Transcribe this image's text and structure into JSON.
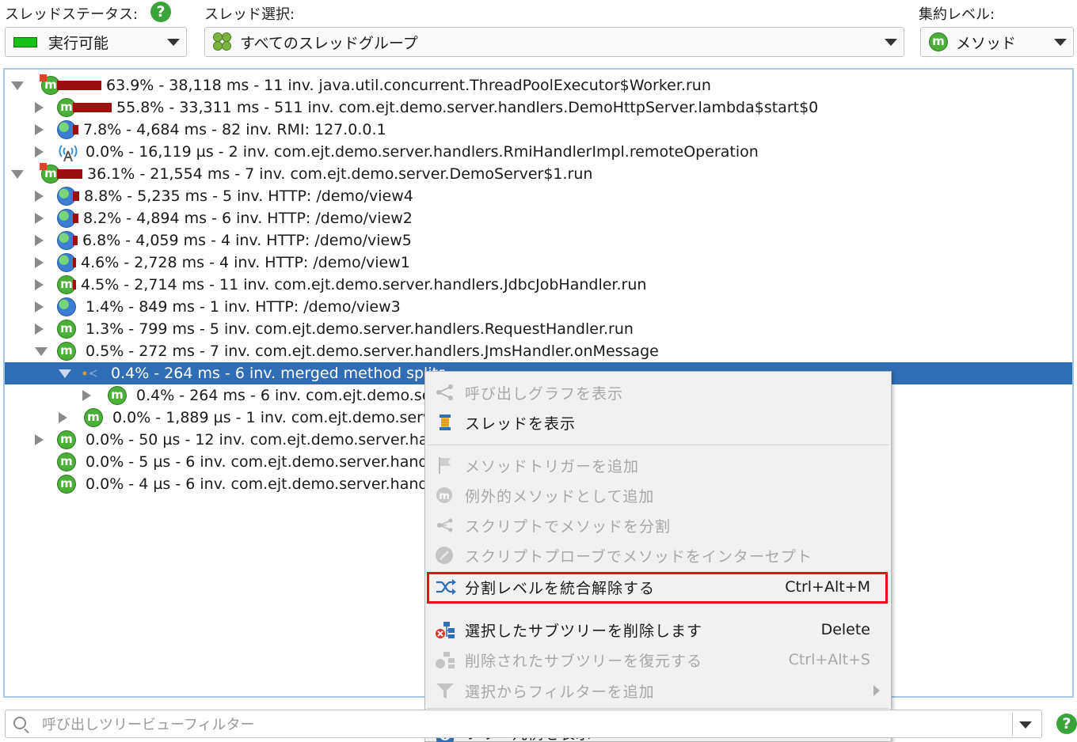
{
  "header": {
    "thread_status_label": "スレッドステータス:",
    "thread_select_label": "スレッド選択:",
    "aggregation_label": "集約レベル:",
    "help_glyph": "?",
    "thread_status_value": "実行可能",
    "thread_select_value": "すべてのスレッドグループ",
    "aggregation_value": "メソッド"
  },
  "icon_glyphs": {
    "method": "m",
    "info": "i"
  },
  "tree": {
    "rows": [
      {
        "text": "63.9% - 38,118 ms - 11 inv. java.util.concurrent.ThreadPoolExecutor$Worker.run",
        "icon": "method-thread-icon",
        "expander": "open",
        "bar": 0.639
      },
      {
        "text": "55.8% - 33,311 ms - 511 inv. com.ejt.demo.server.handlers.DemoHttpServer.lambda$start$0",
        "icon": "method-icon",
        "expander": "closed",
        "bar": 0.558
      },
      {
        "text": "7.8% - 4,684 ms - 82 inv. RMI: 127.0.0.1",
        "icon": "globe-icon",
        "expander": "closed",
        "bar": 0.078
      },
      {
        "text": "0.0% - 16,119 µs - 2 inv. com.ejt.demo.server.handlers.RmiHandlerImpl.remoteOperation",
        "icon": "antenna-icon",
        "expander": "closed",
        "bar": 0
      },
      {
        "text": "36.1% - 21,554 ms - 7 inv. com.ejt.demo.server.DemoServer$1.run",
        "icon": "method-thread-icon",
        "expander": "open",
        "bar": 0.361
      },
      {
        "text": "8.8% - 5,235 ms - 5 inv. HTTP: /demo/view4",
        "icon": "globe-icon",
        "expander": "closed",
        "bar": 0.088
      },
      {
        "text": "8.2% - 4,894 ms - 6 inv. HTTP: /demo/view2",
        "icon": "globe-icon",
        "expander": "closed",
        "bar": 0.082
      },
      {
        "text": "6.8% - 4,059 ms - 4 inv. HTTP: /demo/view5",
        "icon": "globe-icon",
        "expander": "closed",
        "bar": 0.068
      },
      {
        "text": "4.6% - 2,728 ms - 4 inv. HTTP: /demo/view1",
        "icon": "globe-icon",
        "expander": "closed",
        "bar": 0.046
      },
      {
        "text": "4.5% - 2,714 ms - 11 inv. com.ejt.demo.server.handlers.JdbcJobHandler.run",
        "icon": "method-icon",
        "expander": "closed",
        "bar": 0.045
      },
      {
        "text": "1.4% - 849 ms - 1 inv. HTTP: /demo/view3",
        "icon": "globe-icon",
        "expander": "closed",
        "bar": 0
      },
      {
        "text": "1.3% - 799 ms - 5 inv. com.ejt.demo.server.handlers.RequestHandler.run",
        "icon": "method-icon",
        "expander": "closed",
        "bar": 0
      },
      {
        "text": "0.5% - 272 ms - 7 inv. com.ejt.demo.server.handlers.JmsHandler.onMessage",
        "icon": "method-icon",
        "expander": "open",
        "bar": 0
      },
      {
        "text": "0.4% - 264 ms - 6 inv. merged method splits",
        "icon": "merge-icon",
        "expander": "open",
        "bar": 0,
        "selected": true
      },
      {
        "text": "0.4% - 264 ms - 6 inv. com.ejt.demo.ser",
        "icon": "method-icon",
        "expander": "closed",
        "bar": 0
      },
      {
        "text": "0.0% - 1,889 µs - 1 inv. com.ejt.demo.serve",
        "icon": "method-icon",
        "expander": "closed",
        "bar": 0
      },
      {
        "text": "0.0% - 50 µs - 12 inv. com.ejt.demo.server.han",
        "icon": "method-icon",
        "expander": "closed",
        "bar": 0
      },
      {
        "text": "0.0% - 5 µs - 6 inv. com.ejt.demo.server.handle",
        "icon": "method-icon",
        "expander": "none",
        "bar": 0
      },
      {
        "text": "0.0% - 4 µs - 6 inv. com.ejt.demo.server.handle",
        "icon": "method-icon",
        "expander": "none",
        "bar": 0
      }
    ]
  },
  "context_menu": {
    "items": [
      {
        "label": "呼び出しグラフを表示",
        "shortcut": "",
        "disabled": true,
        "icon": "call-graph-icon"
      },
      {
        "label": "スレッドを表示",
        "shortcut": "",
        "disabled": false,
        "icon": "thread-spool-icon"
      },
      {
        "label": "メソッドトリガーを追加",
        "shortcut": "",
        "disabled": true,
        "icon": "flag-icon"
      },
      {
        "label": "例外的メソッドとして追加",
        "shortcut": "",
        "disabled": true,
        "icon": "exceptional-method-icon"
      },
      {
        "label": "スクリプトでメソッドを分割",
        "shortcut": "",
        "disabled": true,
        "icon": "split-icon"
      },
      {
        "label": "スクリプトプローブでメソッドをインターセプト",
        "shortcut": "",
        "disabled": true,
        "icon": "probe-icon"
      },
      {
        "label": "分割レベルを統合解除する",
        "shortcut": "Ctrl+Alt+M",
        "disabled": false,
        "icon": "unmerge-icon",
        "highlighted": true
      },
      {
        "label": "選択したサブツリーを削除します",
        "shortcut": "Delete",
        "disabled": false,
        "icon": "remove-subtree-icon"
      },
      {
        "label": "削除されたサブツリーを復元する",
        "shortcut": "Ctrl+Alt+S",
        "disabled": true,
        "icon": "restore-subtree-icon"
      },
      {
        "label": "選択からフィルターを追加",
        "shortcut": "",
        "disabled": true,
        "icon": "filter-funnel-icon",
        "submenu": true
      },
      {
        "label": "ツリー凡例を表示",
        "shortcut": "",
        "disabled": false,
        "icon": "info-icon"
      }
    ]
  },
  "filter": {
    "placeholder": "呼び出しツリービューフィルター"
  },
  "colors": {
    "selection": "#2f6db5",
    "bar": "#9c0f0f",
    "highlight_box": "#e0141b",
    "method_green": "#4caf3a"
  }
}
